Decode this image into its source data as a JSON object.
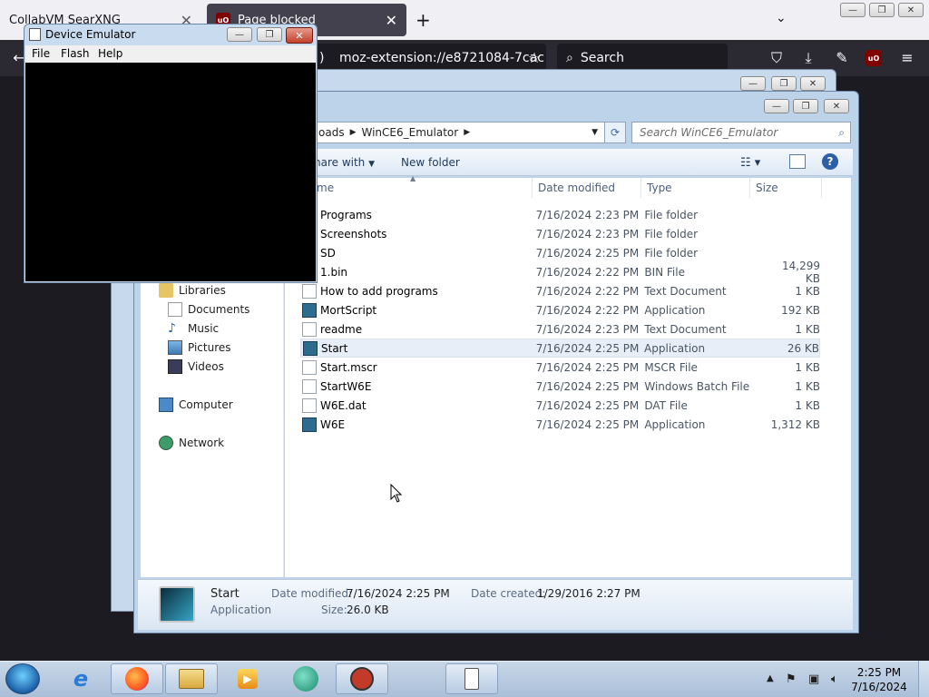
{
  "firefox": {
    "tabs": [
      {
        "title": "CollabVM SearXNG",
        "active": false
      },
      {
        "title": "Page blocked",
        "active": true
      }
    ],
    "url": "moz-extension://e8721084-7cac",
    "url_prefix": ")",
    "search_placeholder": "Search"
  },
  "explorer": {
    "breadcrumb": [
      "oads",
      "WinCE6_Emulator"
    ],
    "search_placeholder": "Search WinCE6_Emulator",
    "toolbar": {
      "share_with": "hare with",
      "new_folder": "New folder"
    },
    "columns": {
      "name": "me",
      "date": "Date modified",
      "type": "Type",
      "size": "Size"
    },
    "nav": {
      "libraries": "Libraries",
      "documents": "Documents",
      "music": "Music",
      "pictures": "Pictures",
      "videos": "Videos",
      "computer": "Computer",
      "network": "Network"
    },
    "files": [
      {
        "name": "Programs",
        "date": "7/16/2024 2:23 PM",
        "type": "File folder",
        "size": "",
        "icon": "folder"
      },
      {
        "name": "Screenshots",
        "date": "7/16/2024 2:23 PM",
        "type": "File folder",
        "size": "",
        "icon": "folder"
      },
      {
        "name": "SD",
        "date": "7/16/2024 2:25 PM",
        "type": "File folder",
        "size": "",
        "icon": "folder"
      },
      {
        "name": "1.bin",
        "date": "7/16/2024 2:22 PM",
        "type": "BIN File",
        "size": "14,299 KB",
        "icon": "bin"
      },
      {
        "name": "How to add programs",
        "date": "7/16/2024 2:22 PM",
        "type": "Text Document",
        "size": "1 KB",
        "icon": "doc"
      },
      {
        "name": "MortScript",
        "date": "7/16/2024 2:22 PM",
        "type": "Application",
        "size": "192 KB",
        "icon": "app"
      },
      {
        "name": "readme",
        "date": "7/16/2024 2:23 PM",
        "type": "Text Document",
        "size": "1 KB",
        "icon": "doc"
      },
      {
        "name": "Start",
        "date": "7/16/2024 2:25 PM",
        "type": "Application",
        "size": "26 KB",
        "icon": "app",
        "selected": true
      },
      {
        "name": "Start.mscr",
        "date": "7/16/2024 2:25 PM",
        "type": "MSCR File",
        "size": "1 KB",
        "icon": "doc"
      },
      {
        "name": "StartW6E",
        "date": "7/16/2024 2:25 PM",
        "type": "Windows Batch File",
        "size": "1 KB",
        "icon": "doc"
      },
      {
        "name": "W6E.dat",
        "date": "7/16/2024 2:25 PM",
        "type": "DAT File",
        "size": "1 KB",
        "icon": "doc"
      },
      {
        "name": "W6E",
        "date": "7/16/2024 2:25 PM",
        "type": "Application",
        "size": "1,312 KB",
        "icon": "app"
      }
    ],
    "details": {
      "name": "Start",
      "kind": "Application",
      "modified_label": "Date modified:",
      "modified_value": "7/16/2024 2:25 PM",
      "size_label": "Size:",
      "size_value": "26.0 KB",
      "created_label": "Date created:",
      "created_value": "1/29/2016 2:27 PM"
    }
  },
  "emulator": {
    "title": "Device Emulator",
    "menu": [
      "File",
      "Flash",
      "Help"
    ]
  },
  "taskbar": {
    "time": "2:25 PM",
    "date": "7/16/2024"
  }
}
